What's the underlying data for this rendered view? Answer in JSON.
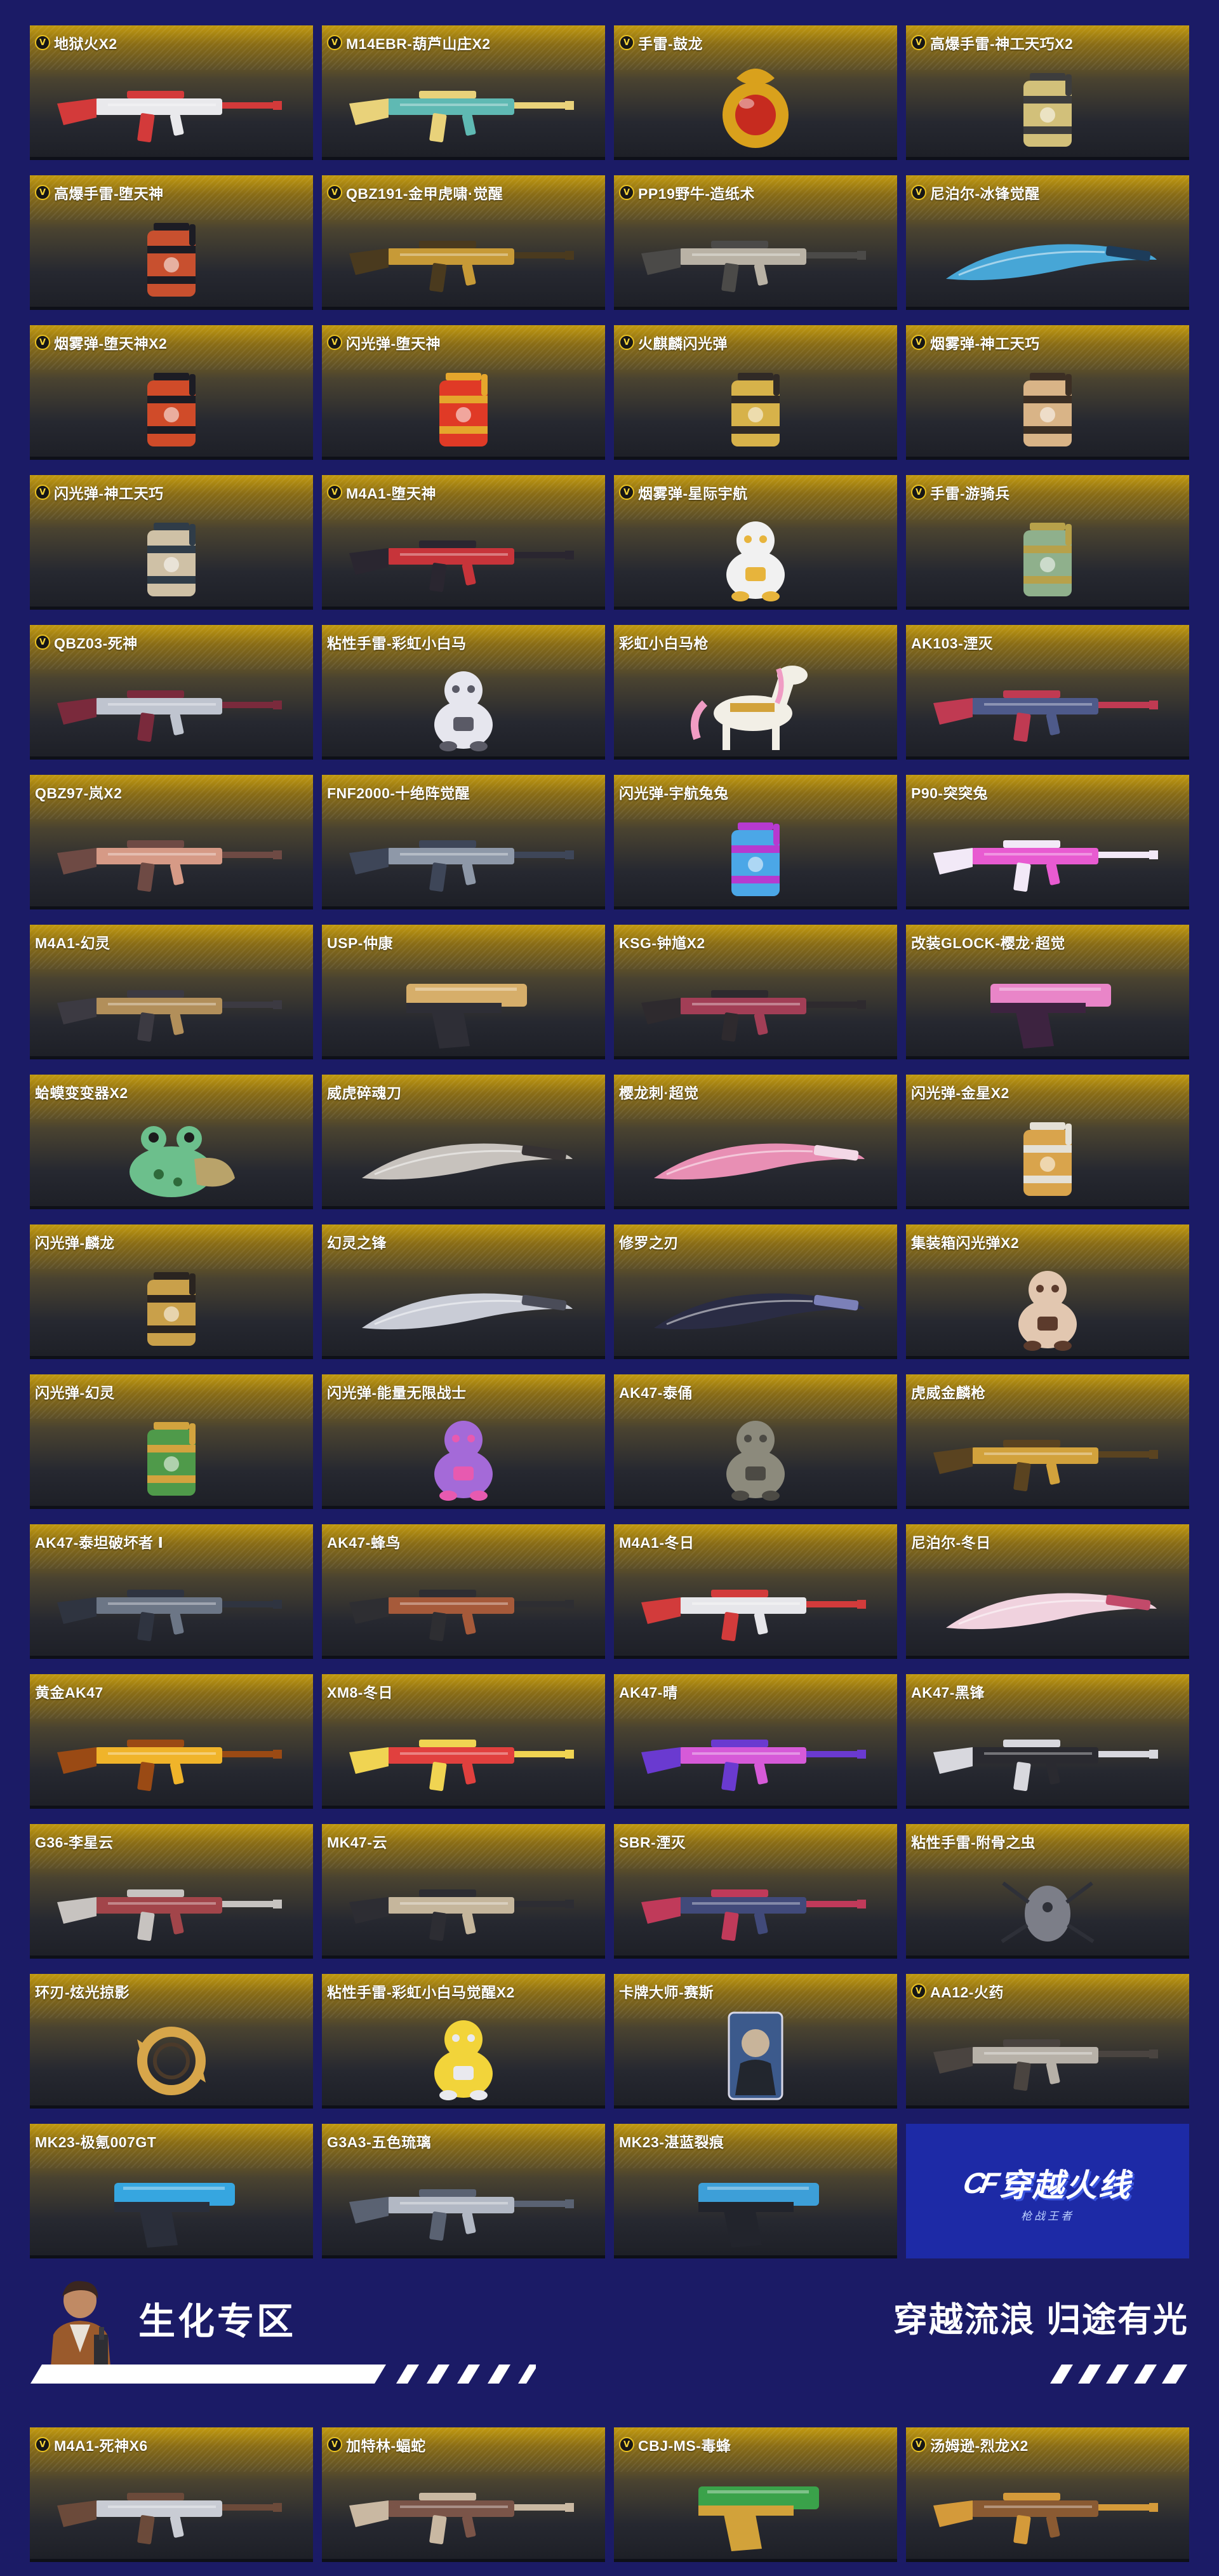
{
  "cards": [
    {
      "label": "地狱火X2",
      "vip": true,
      "art": "rifle",
      "color": "#e9e9ec",
      "accent": "#d33a3a"
    },
    {
      "label": "M14EBR-葫芦山庄X2",
      "vip": true,
      "art": "rifle",
      "color": "#5fb9b3",
      "accent": "#e9d27a"
    },
    {
      "label": "手雷-鼓龙",
      "vip": true,
      "art": "sphere",
      "color": "#d9a11c",
      "accent": "#c62b1f"
    },
    {
      "label": "高爆手雷-神工天巧X2",
      "vip": true,
      "art": "canister",
      "color": "#d2c07a",
      "accent": "#3d3d3d"
    },
    {
      "label": "高爆手雷-堕天神",
      "vip": true,
      "art": "canister",
      "color": "#c8502f",
      "accent": "#1c1c24"
    },
    {
      "label": "QBZ191-金甲虎啸·觉醒",
      "vip": true,
      "art": "rifle",
      "color": "#c79a37",
      "accent": "#4a3a1e"
    },
    {
      "label": "PP19野牛-造纸术",
      "vip": true,
      "art": "rifle",
      "color": "#b9b2a5",
      "accent": "#4b4a48"
    },
    {
      "label": "尼泊尔-冰锋觉醒",
      "vip": true,
      "art": "blade",
      "color": "#47a6d6",
      "accent": "#1d3c5a"
    },
    {
      "label": "烟雾弹-堕天神X2",
      "vip": true,
      "art": "canister",
      "color": "#d04b29",
      "accent": "#1c1c24"
    },
    {
      "label": "闪光弹-堕天神",
      "vip": true,
      "art": "canister",
      "color": "#e03a26",
      "accent": "#e5a62c"
    },
    {
      "label": "火麒麟闪光弹",
      "vip": true,
      "art": "canister",
      "color": "#d7b24a",
      "accent": "#302a26"
    },
    {
      "label": "烟雾弹-神工天巧",
      "vip": true,
      "art": "canister",
      "color": "#d9b487",
      "accent": "#3c2f24"
    },
    {
      "label": "闪光弹-神工天巧",
      "vip": true,
      "art": "canister",
      "color": "#cfc1a6",
      "accent": "#2f3c48"
    },
    {
      "label": "M4A1-堕天神",
      "vip": true,
      "art": "rifle",
      "color": "#c7343a",
      "accent": "#2a2630"
    },
    {
      "label": "烟雾弹-星际宇航",
      "vip": true,
      "art": "figure",
      "color": "#f1f1f1",
      "accent": "#e7b43c"
    },
    {
      "label": "手雷-游骑兵",
      "vip": true,
      "art": "canister",
      "color": "#8fb08c",
      "accent": "#b7a14a"
    },
    {
      "label": "QBZ03-死神",
      "vip": true,
      "art": "rifle",
      "color": "#bfc4cf",
      "accent": "#7a2a3c"
    },
    {
      "label": "粘性手雷-彩虹小白马",
      "vip": false,
      "art": "figure",
      "color": "#e6e6ee",
      "accent": "#5a5a66"
    },
    {
      "label": "彩虹小白马枪",
      "vip": false,
      "art": "horse",
      "color": "#f2efe6",
      "accent": "#f09cc4"
    },
    {
      "label": "AK103-湮灭",
      "vip": false,
      "art": "rifle",
      "color": "#4e5a8a",
      "accent": "#c03a52"
    },
    {
      "label": "QBZ97-岚X2",
      "vip": false,
      "art": "rifle",
      "color": "#d69a86",
      "accent": "#6e4a44"
    },
    {
      "label": "FNF2000-十绝阵觉醒",
      "vip": false,
      "art": "rifle",
      "color": "#8e98a8",
      "accent": "#3e4658"
    },
    {
      "label": "闪光弹-宇航兔兔",
      "vip": false,
      "art": "canister",
      "color": "#4ba7e7",
      "accent": "#b63ad0"
    },
    {
      "label": "P90-突突兔",
      "vip": false,
      "art": "rifle",
      "color": "#e85bd1",
      "accent": "#f2e9f7"
    },
    {
      "label": "M4A1-幻灵",
      "vip": false,
      "art": "rifle",
      "color": "#b28f5a",
      "accent": "#3c3a42"
    },
    {
      "label": "USP-仲康",
      "vip": false,
      "art": "pistol",
      "color": "#d6ae6a",
      "accent": "#2e2e36"
    },
    {
      "label": "KSG-钟馗X2",
      "vip": false,
      "art": "rifle",
      "color": "#a23e56",
      "accent": "#2e2a2e"
    },
    {
      "label": "改装GLOCK-樱龙·超觉",
      "vip": false,
      "art": "pistol",
      "color": "#e985c8",
      "accent": "#3d2340"
    },
    {
      "label": "蛤蟆变变器X2",
      "vip": false,
      "art": "frog",
      "color": "#6cbf8c",
      "accent": "#b9a36a"
    },
    {
      "label": "威虎碎魂刀",
      "vip": false,
      "art": "blade",
      "color": "#c7c2bd",
      "accent": "#363233"
    },
    {
      "label": "樱龙刺·超觉",
      "vip": false,
      "art": "blade",
      "color": "#e88fb4",
      "accent": "#f3d8e6"
    },
    {
      "label": "闪光弹-金星X2",
      "vip": false,
      "art": "canister",
      "color": "#d9a44c",
      "accent": "#e4e0d6"
    },
    {
      "label": "闪光弹-麟龙",
      "vip": false,
      "art": "canister",
      "color": "#c9a04a",
      "accent": "#2a2420"
    },
    {
      "label": "幻灵之锋",
      "vip": false,
      "art": "blade",
      "color": "#c9ccd6",
      "accent": "#4a4c58"
    },
    {
      "label": "修罗之刃",
      "vip": false,
      "art": "blade",
      "color": "#2a2c44",
      "accent": "#7b80b8"
    },
    {
      "label": "集装箱闪光弹X2",
      "vip": false,
      "art": "figure",
      "color": "#e2c7b0",
      "accent": "#5c3b2c"
    },
    {
      "label": "闪光弹-幻灵",
      "vip": false,
      "art": "canister",
      "color": "#4f9a4a",
      "accent": "#d2a33e"
    },
    {
      "label": "闪光弹-能量无限战士",
      "vip": false,
      "art": "figure",
      "color": "#a46ad8",
      "accent": "#e75ab0"
    },
    {
      "label": "AK47-泰俑",
      "vip": false,
      "art": "figure",
      "color": "#8c8a7c",
      "accent": "#4c4a44"
    },
    {
      "label": "虎威金麟枪",
      "vip": false,
      "art": "rifle",
      "color": "#d2a23c",
      "accent": "#5a4320"
    },
    {
      "label": "AK47-泰坦破坏者 Ⅰ",
      "vip": false,
      "art": "rifle",
      "color": "#6c7686",
      "accent": "#2f3440"
    },
    {
      "label": "AK47-蜂鸟",
      "vip": false,
      "art": "rifle",
      "color": "#a65a3a",
      "accent": "#2e2e32"
    },
    {
      "label": "M4A1-冬日",
      "vip": false,
      "art": "rifle",
      "color": "#e6e6ea",
      "accent": "#d23b3b"
    },
    {
      "label": "尼泊尔-冬日",
      "vip": false,
      "art": "blade",
      "color": "#f0d2de",
      "accent": "#c24a6a"
    },
    {
      "label": "黄金AK47",
      "vip": false,
      "art": "rifle",
      "color": "#f0b42a",
      "accent": "#9a4a14"
    },
    {
      "label": "XM8-冬日",
      "vip": false,
      "art": "rifle",
      "color": "#e1403e",
      "accent": "#f0d452"
    },
    {
      "label": "AK47-晴",
      "vip": false,
      "art": "rifle",
      "color": "#d65ad8",
      "accent": "#6a3ad0"
    },
    {
      "label": "AK47-黑锋",
      "vip": false,
      "art": "rifle",
      "color": "#2a2a30",
      "accent": "#d8d8de"
    },
    {
      "label": "G36-李星云",
      "vip": false,
      "art": "rifle",
      "color": "#a2454a",
      "accent": "#c7c3c0"
    },
    {
      "label": "MK47-云",
      "vip": false,
      "art": "rifle",
      "color": "#c5b69c",
      "accent": "#2d2d33"
    },
    {
      "label": "SBR-湮灭",
      "vip": false,
      "art": "rifle",
      "color": "#414a7a",
      "accent": "#c03a5a"
    },
    {
      "label": "粘性手雷-附骨之虫",
      "vip": false,
      "art": "bug",
      "color": "#7c7e88",
      "accent": "#2e3038"
    },
    {
      "label": "环刃-炫光掠影",
      "vip": false,
      "art": "ring",
      "color": "#d7a64a",
      "accent": "#4b3a2a"
    },
    {
      "label": "粘性手雷-彩虹小白马觉醒X2",
      "vip": false,
      "art": "figure",
      "color": "#f2d43a",
      "accent": "#e9e9ee"
    },
    {
      "label": "卡牌大师-赛斯",
      "vip": false,
      "art": "cardart",
      "color": "#3c5a8c",
      "accent": "#c8b49a"
    },
    {
      "label": "AA12-火药",
      "vip": true,
      "art": "rifle",
      "color": "#b7b1a8",
      "accent": "#4a4440"
    },
    {
      "label": "MK23-极氪007GT",
      "vip": false,
      "art": "pistol",
      "color": "#36a6e0",
      "accent": "#2a2e3a"
    },
    {
      "label": "G3A3-五色琉璃",
      "vip": false,
      "art": "rifle",
      "color": "#b2b8c4",
      "accent": "#5a6272"
    },
    {
      "label": "MK23-湛蓝裂痕",
      "vip": false,
      "art": "pistol",
      "color": "#3d9fd8",
      "accent": "#22242c"
    },
    {
      "label": "",
      "vip": false,
      "art": "logo",
      "color": "#1d2aa6",
      "accent": "#ffffff"
    }
  ],
  "logo": {
    "text": "穿越火线",
    "sub": "枪战王者"
  },
  "banner": {
    "title": "生化专区",
    "slogan": "穿越流浪 归途有光"
  },
  "bio_cards": [
    {
      "label": "M4A1-死神X6",
      "vip": true,
      "art": "rifle",
      "color": "#c9ccd4",
      "accent": "#6b4a3a"
    },
    {
      "label": "加特林-蝠蛇",
      "vip": true,
      "art": "rifle",
      "color": "#7a5448",
      "accent": "#c9b8a2"
    },
    {
      "label": "CBJ-MS-毒蜂",
      "vip": true,
      "art": "pistol",
      "color": "#3aa24a",
      "accent": "#d2a23a"
    },
    {
      "label": "汤姆逊-烈龙X2",
      "vip": true,
      "art": "rifle",
      "color": "#8a5a32",
      "accent": "#d49a3a"
    }
  ]
}
